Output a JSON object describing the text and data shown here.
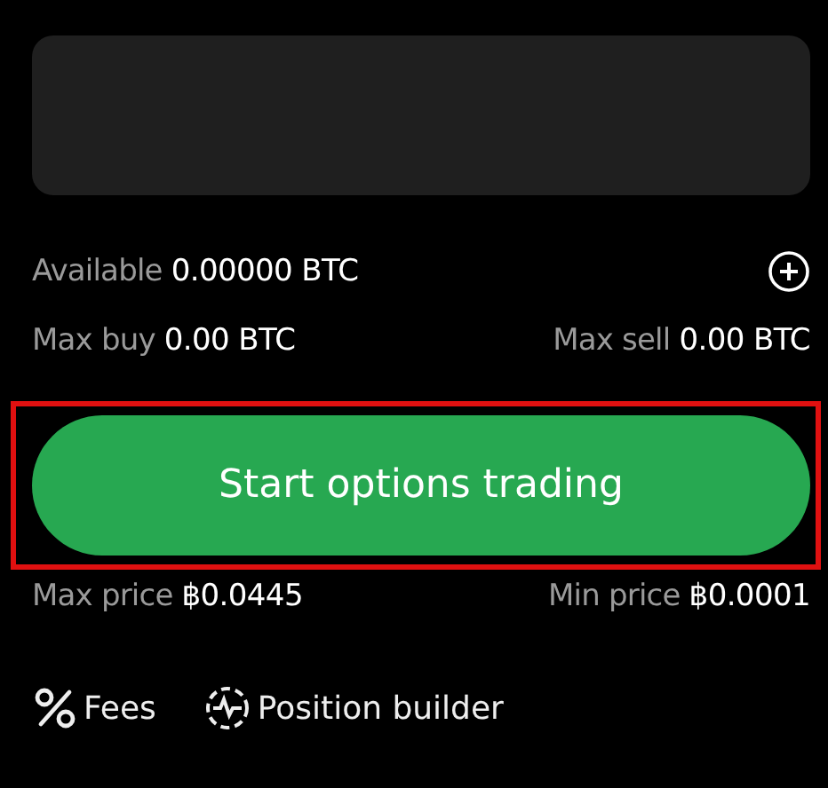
{
  "available": {
    "label": "Available",
    "value": "0.00000 BTC"
  },
  "limits": [
    {
      "label": "Max buy",
      "value": "0.00 BTC"
    },
    {
      "label": "Max sell",
      "value": "0.00 BTC"
    }
  ],
  "submit_button": {
    "label": "Start options trading"
  },
  "prices": [
    {
      "label": "Max price",
      "value": "฿0.0445"
    },
    {
      "label": "Min price",
      "value": "฿0.0001"
    }
  ],
  "links": [
    {
      "kind": "fees",
      "label": "Fees"
    },
    {
      "kind": "builder",
      "label": "Position builder"
    }
  ]
}
